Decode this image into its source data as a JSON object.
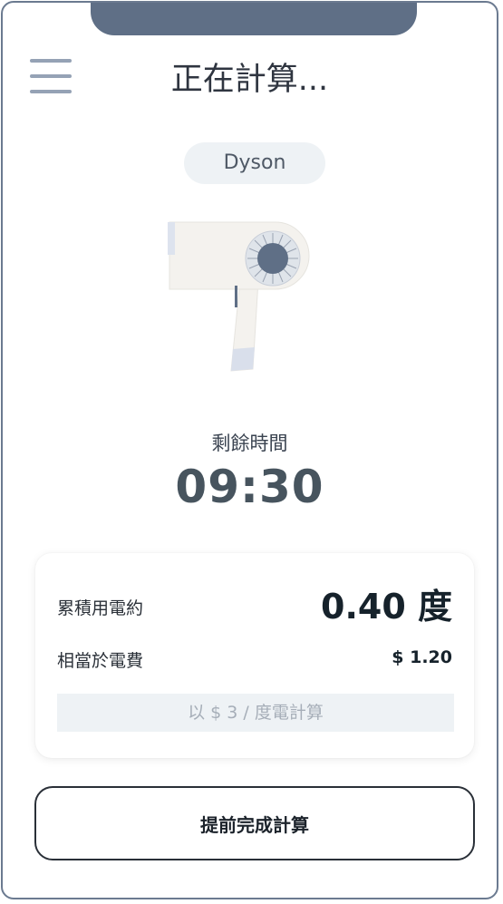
{
  "header": {
    "title": "正在計算..."
  },
  "device": {
    "brand": "Dyson"
  },
  "timer": {
    "label": "剩餘時間",
    "value": "09:30"
  },
  "summary": {
    "energy_label": "累積用電約",
    "energy_value": "0.40 度",
    "cost_label": "相當於電費",
    "cost_value": "$ 1.20",
    "rate_note": "以 $ 3 / 度電計算"
  },
  "actions": {
    "finish_label": "提前完成計算"
  },
  "icons": {
    "menu": "hamburger-menu-icon",
    "device": "hair-dryer-icon"
  },
  "colors": {
    "accent": "#5f6f86",
    "text": "#2f3540",
    "chip_bg": "#eef2f5"
  }
}
